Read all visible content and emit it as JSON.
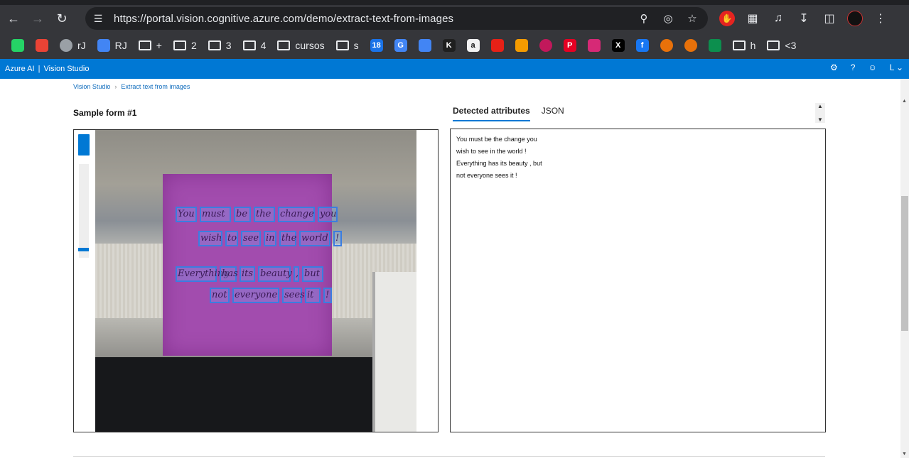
{
  "browser": {
    "url": "https://portal.vision.cognitive.azure.com/demo/extract-text-from-images",
    "bookmarks": [
      {
        "label": "",
        "icon": "whatsapp-icon",
        "color": "#25d366"
      },
      {
        "label": "",
        "icon": "gmail-icon",
        "color": "#ea4335"
      },
      {
        "label": "rJ",
        "icon": "globe-icon",
        "color": "#9aa0a6"
      },
      {
        "label": "RJ",
        "icon": "google-translate-icon",
        "color": "#4285f4"
      },
      {
        "label": "+",
        "icon": "folder-icon"
      },
      {
        "label": "2",
        "icon": "folder-icon"
      },
      {
        "label": "3",
        "icon": "folder-icon"
      },
      {
        "label": "4",
        "icon": "folder-icon"
      },
      {
        "label": "cursos",
        "icon": "folder-icon"
      },
      {
        "label": "s",
        "icon": "folder-icon"
      },
      {
        "label": "",
        "icon": "calendar-icon",
        "color": "#1a73e8",
        "text": "18"
      },
      {
        "label": "",
        "icon": "translate-icon",
        "color": "#4285f4",
        "text": "G"
      },
      {
        "label": "",
        "icon": "assistant-icon",
        "color": "#4285f4"
      },
      {
        "label": "",
        "icon": "k-app-icon",
        "color": "#1f1f1f",
        "text": "K"
      },
      {
        "label": "",
        "icon": "amazon-icon",
        "color": "#f2f2f2",
        "text": "a"
      },
      {
        "label": "",
        "icon": "youtube-music-icon",
        "color": "#e62117"
      },
      {
        "label": "",
        "icon": "orange-app-icon",
        "color": "#f59b00"
      },
      {
        "label": "",
        "icon": "red-arc-icon",
        "color": "#c2185b"
      },
      {
        "label": "",
        "icon": "pinterest-icon",
        "color": "#e60023",
        "text": "P"
      },
      {
        "label": "",
        "icon": "instagram-icon",
        "color": "#d62976"
      },
      {
        "label": "",
        "icon": "x-icon",
        "color": "#000000",
        "text": "X"
      },
      {
        "label": "",
        "icon": "facebook-icon",
        "color": "#1877f2",
        "text": "f"
      },
      {
        "label": "",
        "icon": "orange-ring-icon",
        "color": "#e8710a"
      },
      {
        "label": "",
        "icon": "orange-ring-icon",
        "color": "#e8710a"
      },
      {
        "label": "",
        "icon": "edge-icon",
        "color": "#0c8f4e"
      },
      {
        "label": "h",
        "icon": "folder-icon"
      },
      {
        "label": "<3",
        "icon": "folder-icon"
      }
    ]
  },
  "azure": {
    "brand": "Azure AI",
    "separator": "|",
    "product": "Vision Studio",
    "avatar_initial": "L"
  },
  "breadcrumb": {
    "root": "Vision Studio",
    "current": "Extract text from images"
  },
  "sample": {
    "title": "Sample form #1",
    "note_lines": [
      [
        "You",
        "must",
        "be",
        "the",
        "change",
        "you"
      ],
      [
        "wish",
        "to",
        "see",
        "in",
        "the",
        "world",
        "!"
      ],
      [
        "Everything",
        "has",
        "its",
        "beauty",
        ",",
        "but"
      ],
      [
        "not",
        "everyone",
        "sees",
        "it",
        "!"
      ]
    ]
  },
  "results": {
    "tabs": [
      "Detected attributes",
      "JSON"
    ],
    "active_tab": "Detected attributes",
    "lines": [
      "You must be the change you",
      "wish to see in the world !",
      "Everything has its beauty , but",
      "not everyone sees it !"
    ]
  }
}
